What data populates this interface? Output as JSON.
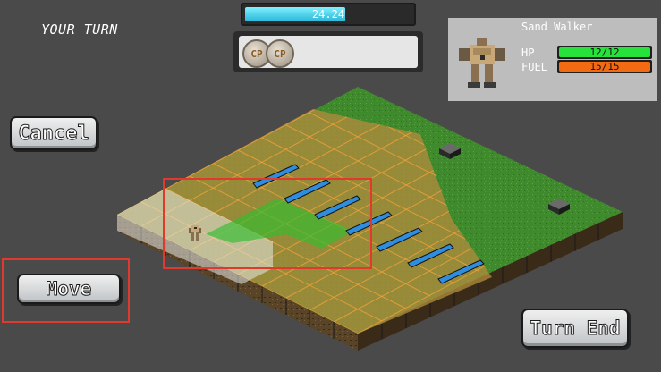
{
  "turn_label": "YOUR TURN",
  "timer": {
    "value_text": "24.24",
    "fill_fraction": 0.6
  },
  "command_points": {
    "coins": [
      "CP",
      "CP"
    ]
  },
  "unit": {
    "name": "Sand Walker",
    "hp_label": "HP",
    "hp_text": "12/12",
    "hp_fraction": 1.0,
    "fuel_label": "FUEL",
    "fuel_text": "15/15",
    "fuel_fraction": 1.0
  },
  "buttons": {
    "cancel": "Cancel",
    "move": "Move",
    "turn_end": "Turn End"
  },
  "colors": {
    "background": "#4a4a4a",
    "timer": "#2ab6d8",
    "hp": "#27e23a",
    "fuel": "#f26a12",
    "grass": "#3f8a2c",
    "movable_overlay": "#b08a3c",
    "path_overlay": "#2fbf2f",
    "selection_overlay": "#d8dcd8",
    "water": "#2f8de0",
    "highlight": "#e03a2e"
  },
  "icons": {
    "unit_portrait": "mech-walker-icon",
    "map_unit": "mech-walker-icon",
    "enemy_units": "bunker-icon"
  }
}
